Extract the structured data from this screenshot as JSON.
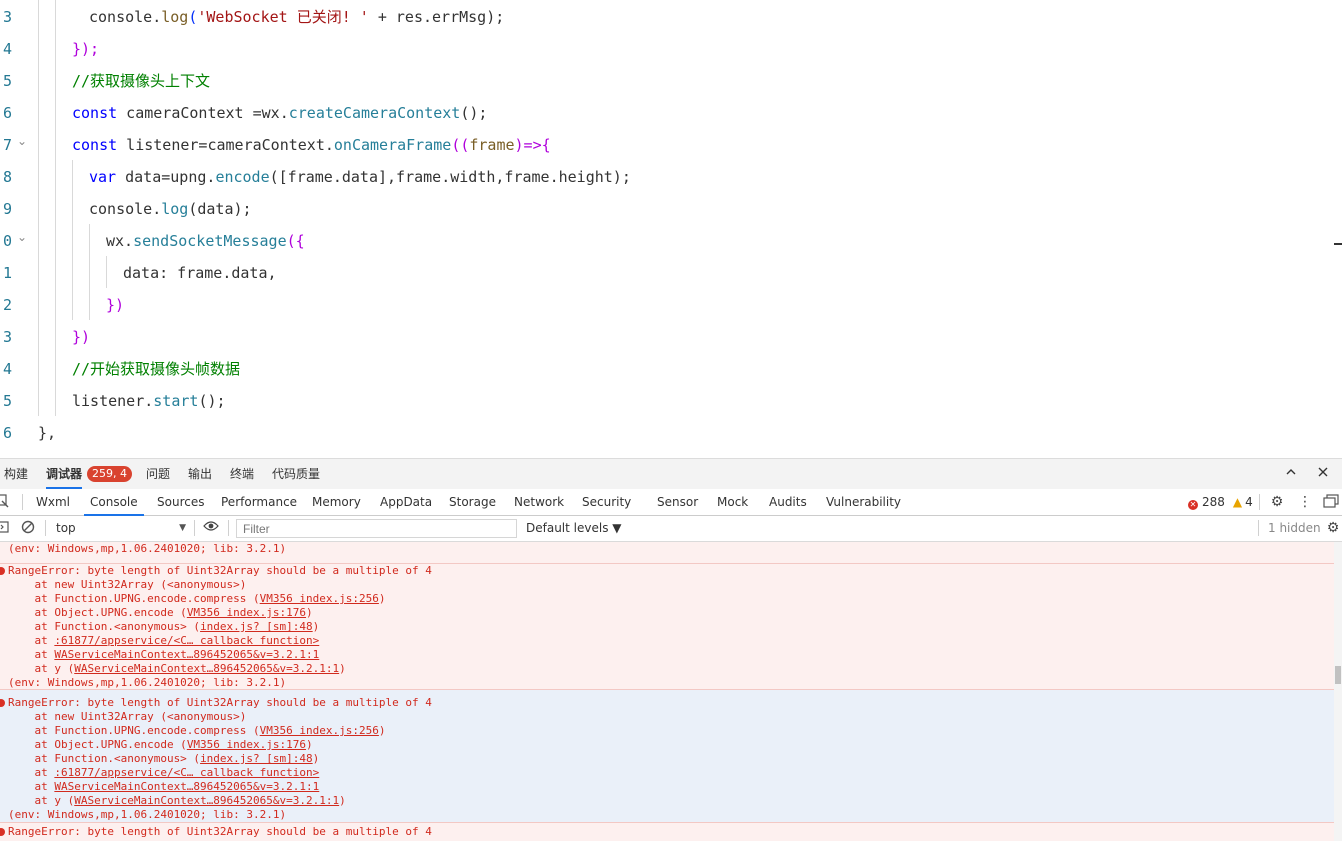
{
  "editor": {
    "lines": [
      {
        "num": "3"
      },
      {
        "num": "4"
      },
      {
        "num": "5"
      },
      {
        "num": "6"
      },
      {
        "num": "7"
      },
      {
        "num": "8"
      },
      {
        "num": "9"
      },
      {
        "num": "0"
      },
      {
        "num": "1"
      },
      {
        "num": "2"
      },
      {
        "num": "3"
      },
      {
        "num": "4"
      },
      {
        "num": "5"
      },
      {
        "num": "6"
      }
    ],
    "code": {
      "l1_a": "console.",
      "l1_b": "log",
      "l1_c": "(",
      "l1_d": "'WebSocket 已关闭! '",
      "l1_e": " + res.errMsg);",
      "l2": "});",
      "l3": "//获取摄像头上下文",
      "l4_kw": "const",
      "l4_a": " cameraContext =wx.",
      "l4_b": "createCameraContext",
      "l4_c": "();",
      "l5_kw": "const",
      "l5_a": " listener=cameraContext.",
      "l5_b": "onCameraFrame",
      "l5_c": "((",
      "l5_d": "frame",
      "l5_e": ")=>{",
      "l6_kw": "var",
      "l6_a": " data=upng.",
      "l6_b": "encode",
      "l6_c": "([frame.data],frame.width,frame.height);",
      "l7_a": "console.",
      "l7_b": "log",
      "l7_c": "(data);",
      "l8_a": "wx.",
      "l8_b": "sendSocketMessage",
      "l8_c": "({",
      "l9": "data: frame.data,",
      "l10": "})",
      "l11": "})",
      "l12": "//开始获取摄像头帧数据",
      "l13_a": "listener.",
      "l13_b": "start",
      "l13_c": "();",
      "l14": "},"
    }
  },
  "panel_tabs": {
    "build": "构建",
    "debugger": "调试器",
    "debugger_badge": "259, 4",
    "problems": "问题",
    "output": "输出",
    "terminal": "终端",
    "code_quality": "代码质量"
  },
  "devtools_tabs": [
    "Wxml",
    "Console",
    "Sources",
    "Performance",
    "Memory",
    "AppData",
    "Storage",
    "Network",
    "Security",
    "Sensor",
    "Mock",
    "Audits",
    "Vulnerability"
  ],
  "counts": {
    "errors": "288",
    "warnings": "4"
  },
  "filter_bar": {
    "context": "top",
    "filter_placeholder": "Filter",
    "levels": "Default levels ▼",
    "hidden": "1 hidden"
  },
  "console": {
    "env_line": "(env: Windows,mp,1.06.2401020; lib: 3.2.1)",
    "error_msg": "RangeError: byte length of Uint32Array should be a multiple of 4",
    "stack": [
      {
        "prefix": "    at new Uint32Array (<anonymous>)",
        "link": "",
        "suffix": ""
      },
      {
        "prefix": "    at Function.UPNG.encode.compress (",
        "link": "VM356 index.js:256",
        "suffix": ")"
      },
      {
        "prefix": "    at Object.UPNG.encode (",
        "link": "VM356 index.js:176",
        "suffix": ")"
      },
      {
        "prefix": "    at Function.<anonymous> (",
        "link": "index.js? [sm]:48",
        "suffix": ")"
      },
      {
        "prefix": "    at ",
        "link": ":61877/appservice/<C… callback function>",
        "suffix": ""
      },
      {
        "prefix": "    at ",
        "link": "WAServiceMainContext…896452065&v=3.2.1:1",
        "suffix": ""
      },
      {
        "prefix": "    at y (",
        "link": "WAServiceMainContext…896452065&v=3.2.1:1",
        "suffix": ")"
      }
    ]
  },
  "colors": {
    "accent": "#1a73e8",
    "error": "#d12a1e",
    "badge": "#d9432f",
    "warning": "#e8a400"
  }
}
